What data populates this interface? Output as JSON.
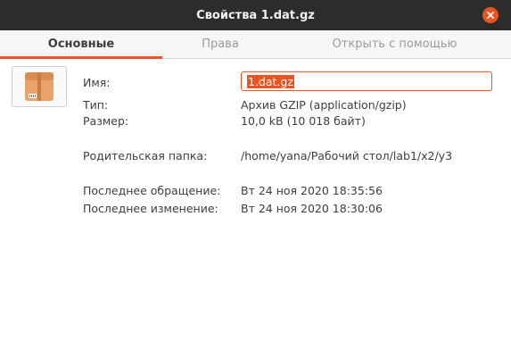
{
  "window": {
    "title": "Свойства 1.dat.gz"
  },
  "tabs": [
    {
      "label": "Основные",
      "active": true
    },
    {
      "label": "Права",
      "active": false
    },
    {
      "label": "Открыть с помощью",
      "active": false
    }
  ],
  "icons": {
    "file": "package-icon",
    "close": "close-icon"
  },
  "colors": {
    "accent": "#e95420",
    "titlebar": "#2c2c2c"
  },
  "props": {
    "name_label": "Имя:",
    "name_value": "1.dat.gz",
    "type_label": "Тип:",
    "type_value": "Архив GZIP (application/gzip)",
    "size_label": "Размер:",
    "size_value": "10,0 kB (10 018 байт)",
    "parent_label": "Родительская папка:",
    "parent_value": "/home/yana/Рабочий стол/lab1/x2/y3",
    "accessed_label": "Последнее обращение:",
    "accessed_value": "Вт 24 ноя 2020 18:35:56",
    "modified_label": "Последнее изменение:",
    "modified_value": "Вт 24 ноя 2020 18:30:06"
  }
}
